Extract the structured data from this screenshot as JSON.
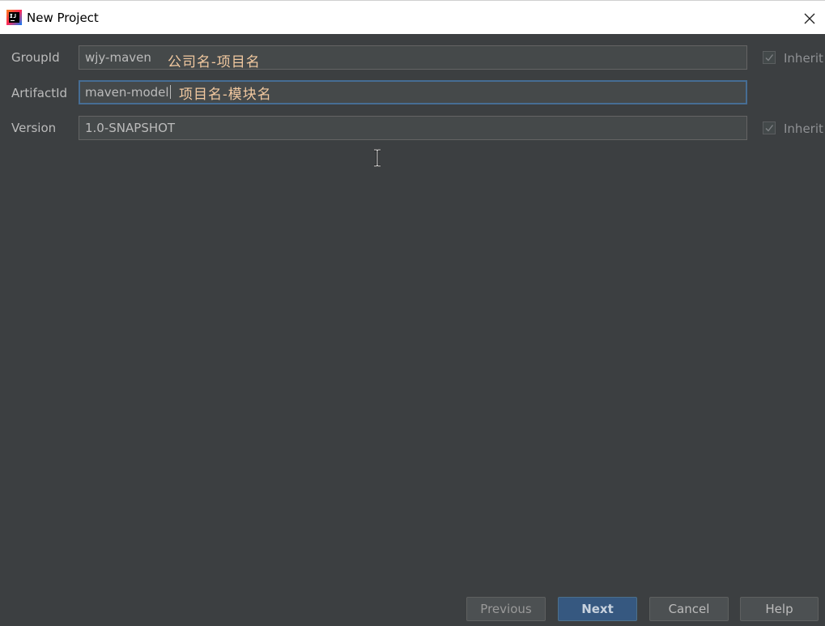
{
  "window": {
    "title": "New Project",
    "icon": "intellij-idea-icon",
    "close_icon": "close-icon"
  },
  "form": {
    "group_id": {
      "label": "GroupId",
      "value": "wjy-maven",
      "annotation": "公司名-项目名",
      "inherit_label": "Inherit",
      "inherit_checked": true
    },
    "artifact_id": {
      "label": "ArtifactId",
      "value": "maven-model",
      "annotation": "项目名-模块名"
    },
    "version": {
      "label": "Version",
      "value": "1.0-SNAPSHOT",
      "inherit_label": "Inherit",
      "inherit_checked": true
    }
  },
  "buttons": {
    "previous": "Previous",
    "next": "Next",
    "cancel": "Cancel",
    "help": "Help"
  },
  "colors": {
    "background": "#3c3f41",
    "field_background": "#45494a",
    "focus_border": "#466d94",
    "primary_button": "#365880",
    "annotation": "#f2c9a0"
  }
}
